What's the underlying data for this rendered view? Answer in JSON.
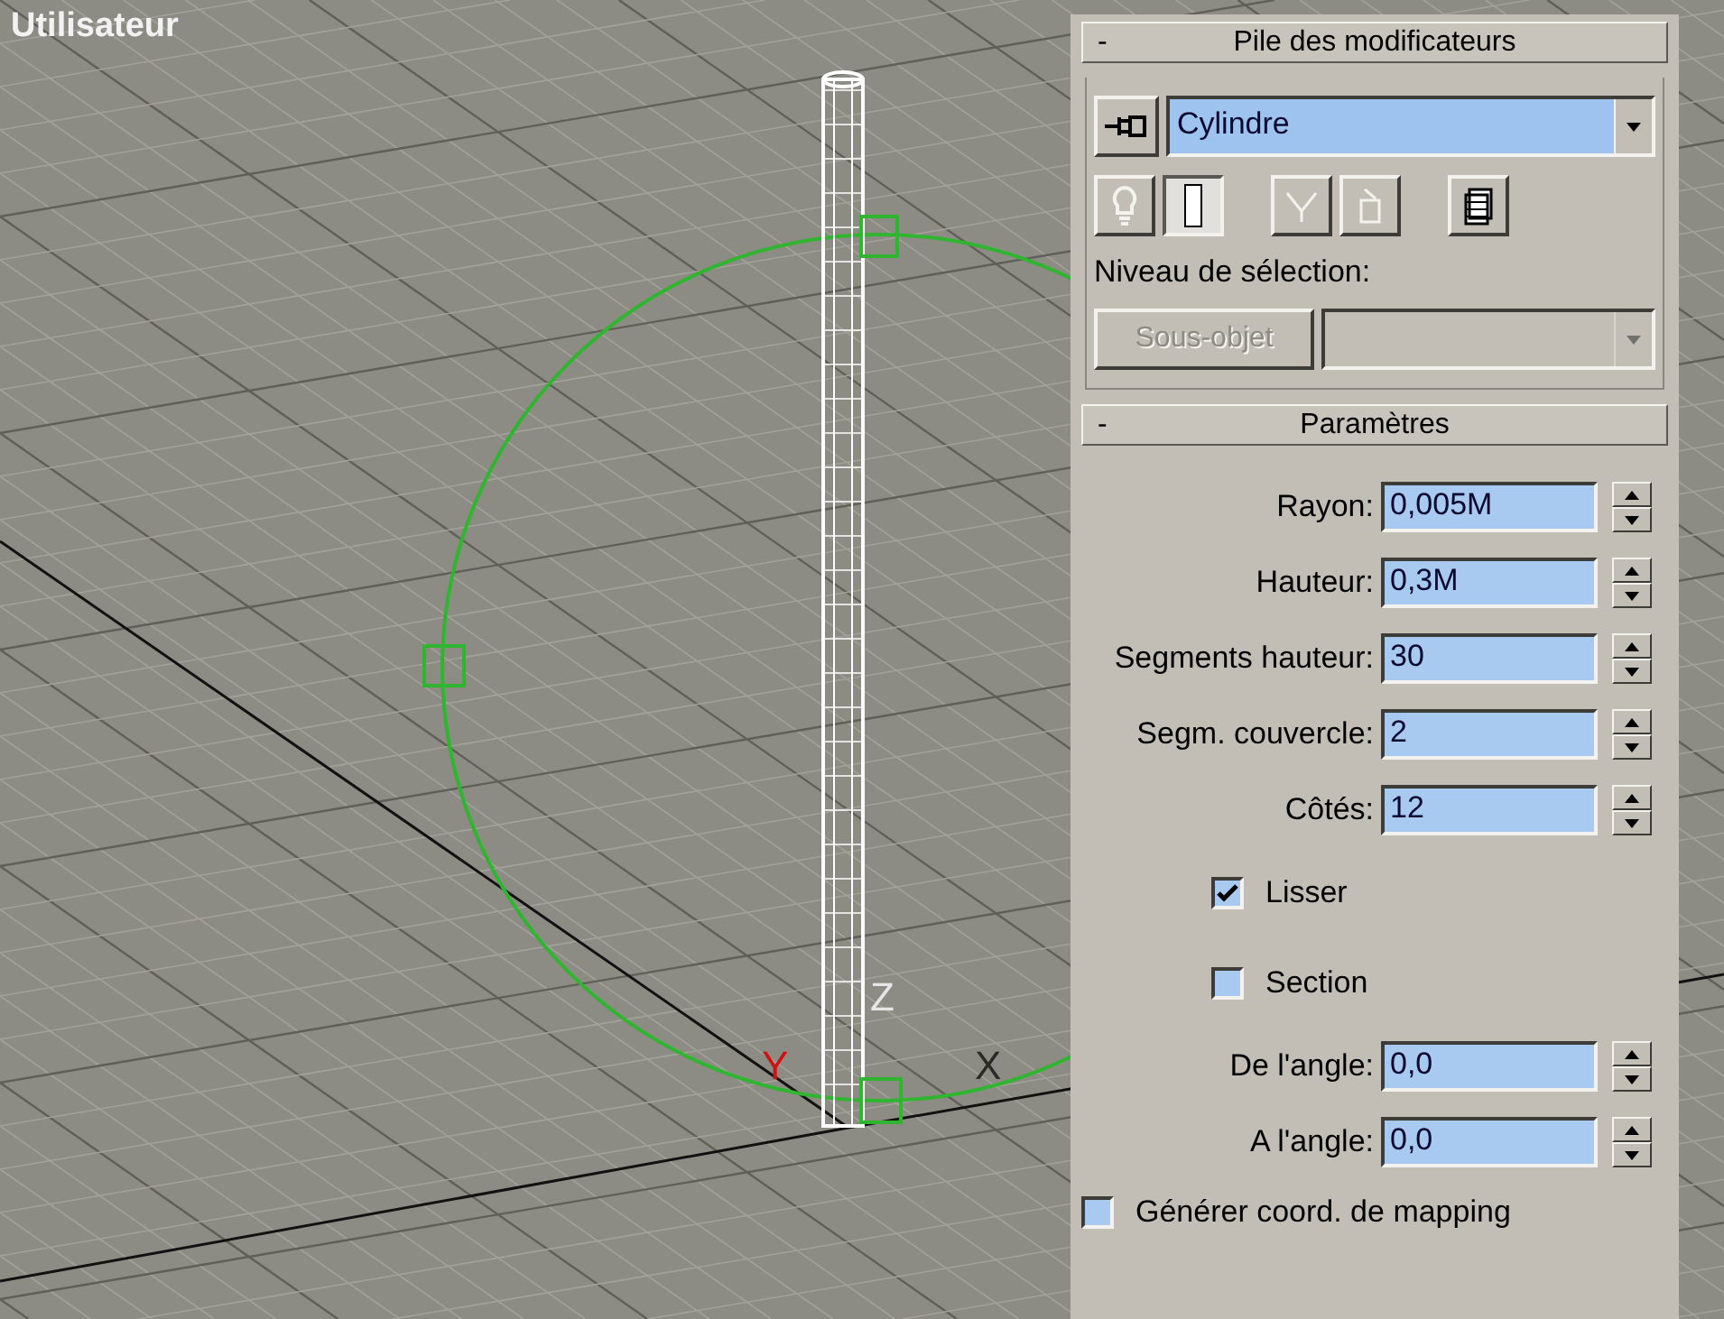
{
  "viewport": {
    "label": "Utilisateur",
    "axis_labels": [
      {
        "kind": "y",
        "text": "Y"
      },
      {
        "kind": "z",
        "text": "Z"
      },
      {
        "kind": "x",
        "text": "X"
      }
    ]
  },
  "modifier_stack": {
    "collapse_sign": "-",
    "title": "Pile des modificateurs",
    "modifier": "Cylindre",
    "tool_buttons": [
      {
        "kind": "bulb",
        "pressed": false,
        "disabled": true
      },
      {
        "kind": "ibeam",
        "pressed": true,
        "disabled": false
      },
      {
        "kind": "fork",
        "pressed": false,
        "disabled": true
      },
      {
        "kind": "cup",
        "pressed": false,
        "disabled": true
      },
      {
        "kind": "stack",
        "pressed": false,
        "disabled": false
      }
    ],
    "selection_label": "Niveau de sélection:",
    "subobject": {
      "label": "Sous-objet",
      "disabled": true
    },
    "subobject_dropdown": {
      "disabled": true
    }
  },
  "parameters": {
    "collapse_sign": "-",
    "title": "Paramètres",
    "rows": [
      {
        "kind": "spinner",
        "label": "Rayon:",
        "value": "0,005M"
      },
      {
        "kind": "spinner",
        "label": "Hauteur:",
        "value": "0,3M"
      },
      {
        "kind": "spinner",
        "label": "Segments hauteur:",
        "value": "30"
      },
      {
        "kind": "spinner",
        "label": "Segm. couvercle:",
        "value": "2"
      },
      {
        "kind": "spinner",
        "label": "Côtés:",
        "value": "12"
      },
      {
        "kind": "checkbox",
        "label": "Lisser",
        "checked": true
      },
      {
        "kind": "checkbox",
        "label": "Section",
        "checked": false
      },
      {
        "kind": "spinner",
        "label": "De l'angle:",
        "value": "0,0"
      },
      {
        "kind": "spinner",
        "label": "A l'angle:",
        "value": "0,0"
      },
      {
        "kind": "wide_checkbox",
        "label": "Générer coord. de mapping",
        "checked": false
      }
    ]
  }
}
